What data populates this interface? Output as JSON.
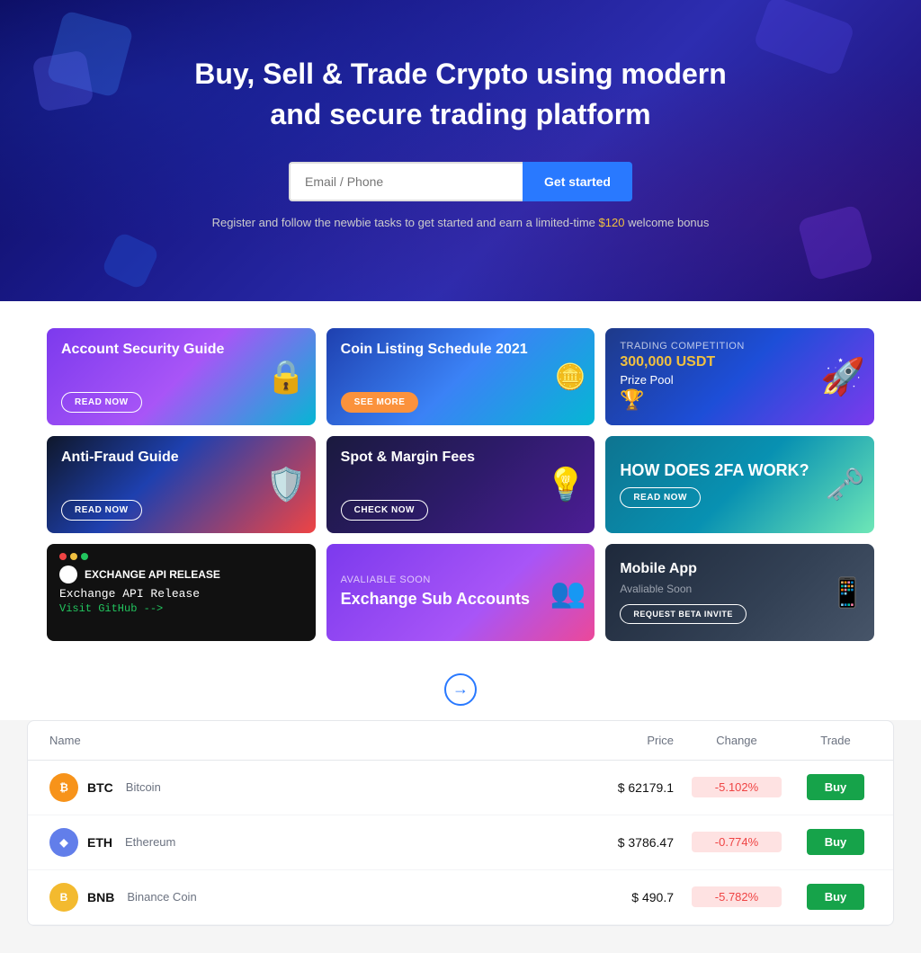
{
  "hero": {
    "title": "Buy, Sell & Trade Crypto using modern and secure trading platform",
    "input_placeholder": "Email / Phone",
    "cta_label": "Get started",
    "sub_text_before": "Register and follow the newbie tasks to get started and earn a limited-time ",
    "sub_highlight": "$120",
    "sub_text_after": " welcome bonus"
  },
  "cards": [
    {
      "id": "security",
      "label": "",
      "title": "Account Security Guide",
      "btn": "READ NOW",
      "btn_filled": false,
      "icon": "🔒"
    },
    {
      "id": "coin-listing",
      "label": "",
      "title": "Coin Listing Schedule 2021",
      "btn": "SEE MORE",
      "btn_filled": true,
      "icon": "₿"
    },
    {
      "id": "trading",
      "label": "Trading Competition",
      "title": "300,000 USDT",
      "title2": "Prize Pool",
      "btn": "",
      "icon": "🚀"
    },
    {
      "id": "antifraud",
      "label": "",
      "title": "Anti-Fraud Guide",
      "btn": "READ NOW",
      "btn_filled": false,
      "icon": "🔐"
    },
    {
      "id": "spot",
      "label": "",
      "title": "Spot & Margin Fees",
      "btn": "CHECK NOW",
      "btn_filled": false,
      "icon": "💡"
    },
    {
      "id": "2fa",
      "label": "",
      "title": "HOW DOES 2FA WORK?",
      "btn": "READ NOW",
      "btn_filled": false,
      "icon": "🔑"
    },
    {
      "id": "api",
      "label": "EXCHANGE API RELEASE",
      "title": "Exchange API Release",
      "link": "Visit GitHub -->",
      "btn": "",
      "icon": ""
    },
    {
      "id": "sub-accounts",
      "label": "AVALIABLE SOON",
      "title": "Exchange Sub Accounts",
      "btn": "",
      "icon": "👥"
    },
    {
      "id": "mobile",
      "label": "Mobile App",
      "title": "Avaliable Soon",
      "btn": "REQUEST BETA INVITE",
      "btn_filled": false,
      "icon": "📱"
    }
  ],
  "arrow": "⮕",
  "table": {
    "headers": {
      "name": "Name",
      "price": "Price",
      "change": "Change",
      "trade": "Trade"
    },
    "rows": [
      {
        "symbol": "BTC",
        "name": "Bitcoin",
        "price": "$ 62179.1",
        "change": "-5.102%",
        "change_type": "neg",
        "trade_label": "Buy",
        "icon_label": "₿"
      },
      {
        "symbol": "ETH",
        "name": "Ethereum",
        "price": "$ 3786.47",
        "change": "-0.774%",
        "change_type": "neg",
        "trade_label": "Buy",
        "icon_label": "◆"
      },
      {
        "symbol": "BNB",
        "name": "Binance Coin",
        "price": "$ 490.7",
        "change": "-5.782%",
        "change_type": "neg",
        "trade_label": "Buy",
        "icon_label": "B"
      }
    ]
  }
}
